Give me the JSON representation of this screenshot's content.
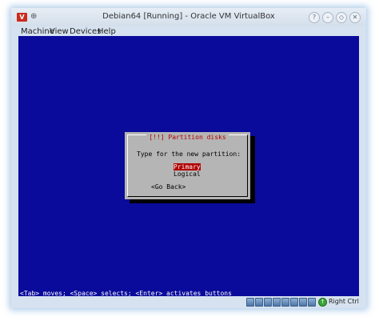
{
  "window": {
    "title": "Debian64 [Running] - Oracle VM VirtualBox",
    "app_icon_text": "V",
    "pin_icon": "pin-icon",
    "controls": {
      "help": "?",
      "minimize": "–",
      "maximize": "◇",
      "close": "✕"
    }
  },
  "menubar": {
    "items": [
      "Machine",
      "View",
      "Devices",
      "Help"
    ]
  },
  "installer": {
    "dialog_title": "[!!] Partition disks",
    "prompt": "Type for the new partition:",
    "options": [
      {
        "label": "Primary",
        "selected": true
      },
      {
        "label": "Logical",
        "selected": false
      }
    ],
    "go_back": "<Go Back>",
    "help_line": "<Tab> moves; <Space> selects; <Enter> activates buttons",
    "colors": {
      "background": "#0a0b9b",
      "dialog": "#b5b5b5",
      "highlight": "#b00000",
      "title": "#b00000"
    }
  },
  "statusbar": {
    "icons": [
      "hard-disk-icon",
      "optical-drive-icon",
      "usb-icon",
      "shared-folders-icon",
      "network-icon",
      "display-icon",
      "video-capture-icon",
      "cpu-icon",
      "mouse-integration-icon"
    ],
    "host_key_icon": "host-key-icon",
    "host_key": "Right Ctrl"
  }
}
